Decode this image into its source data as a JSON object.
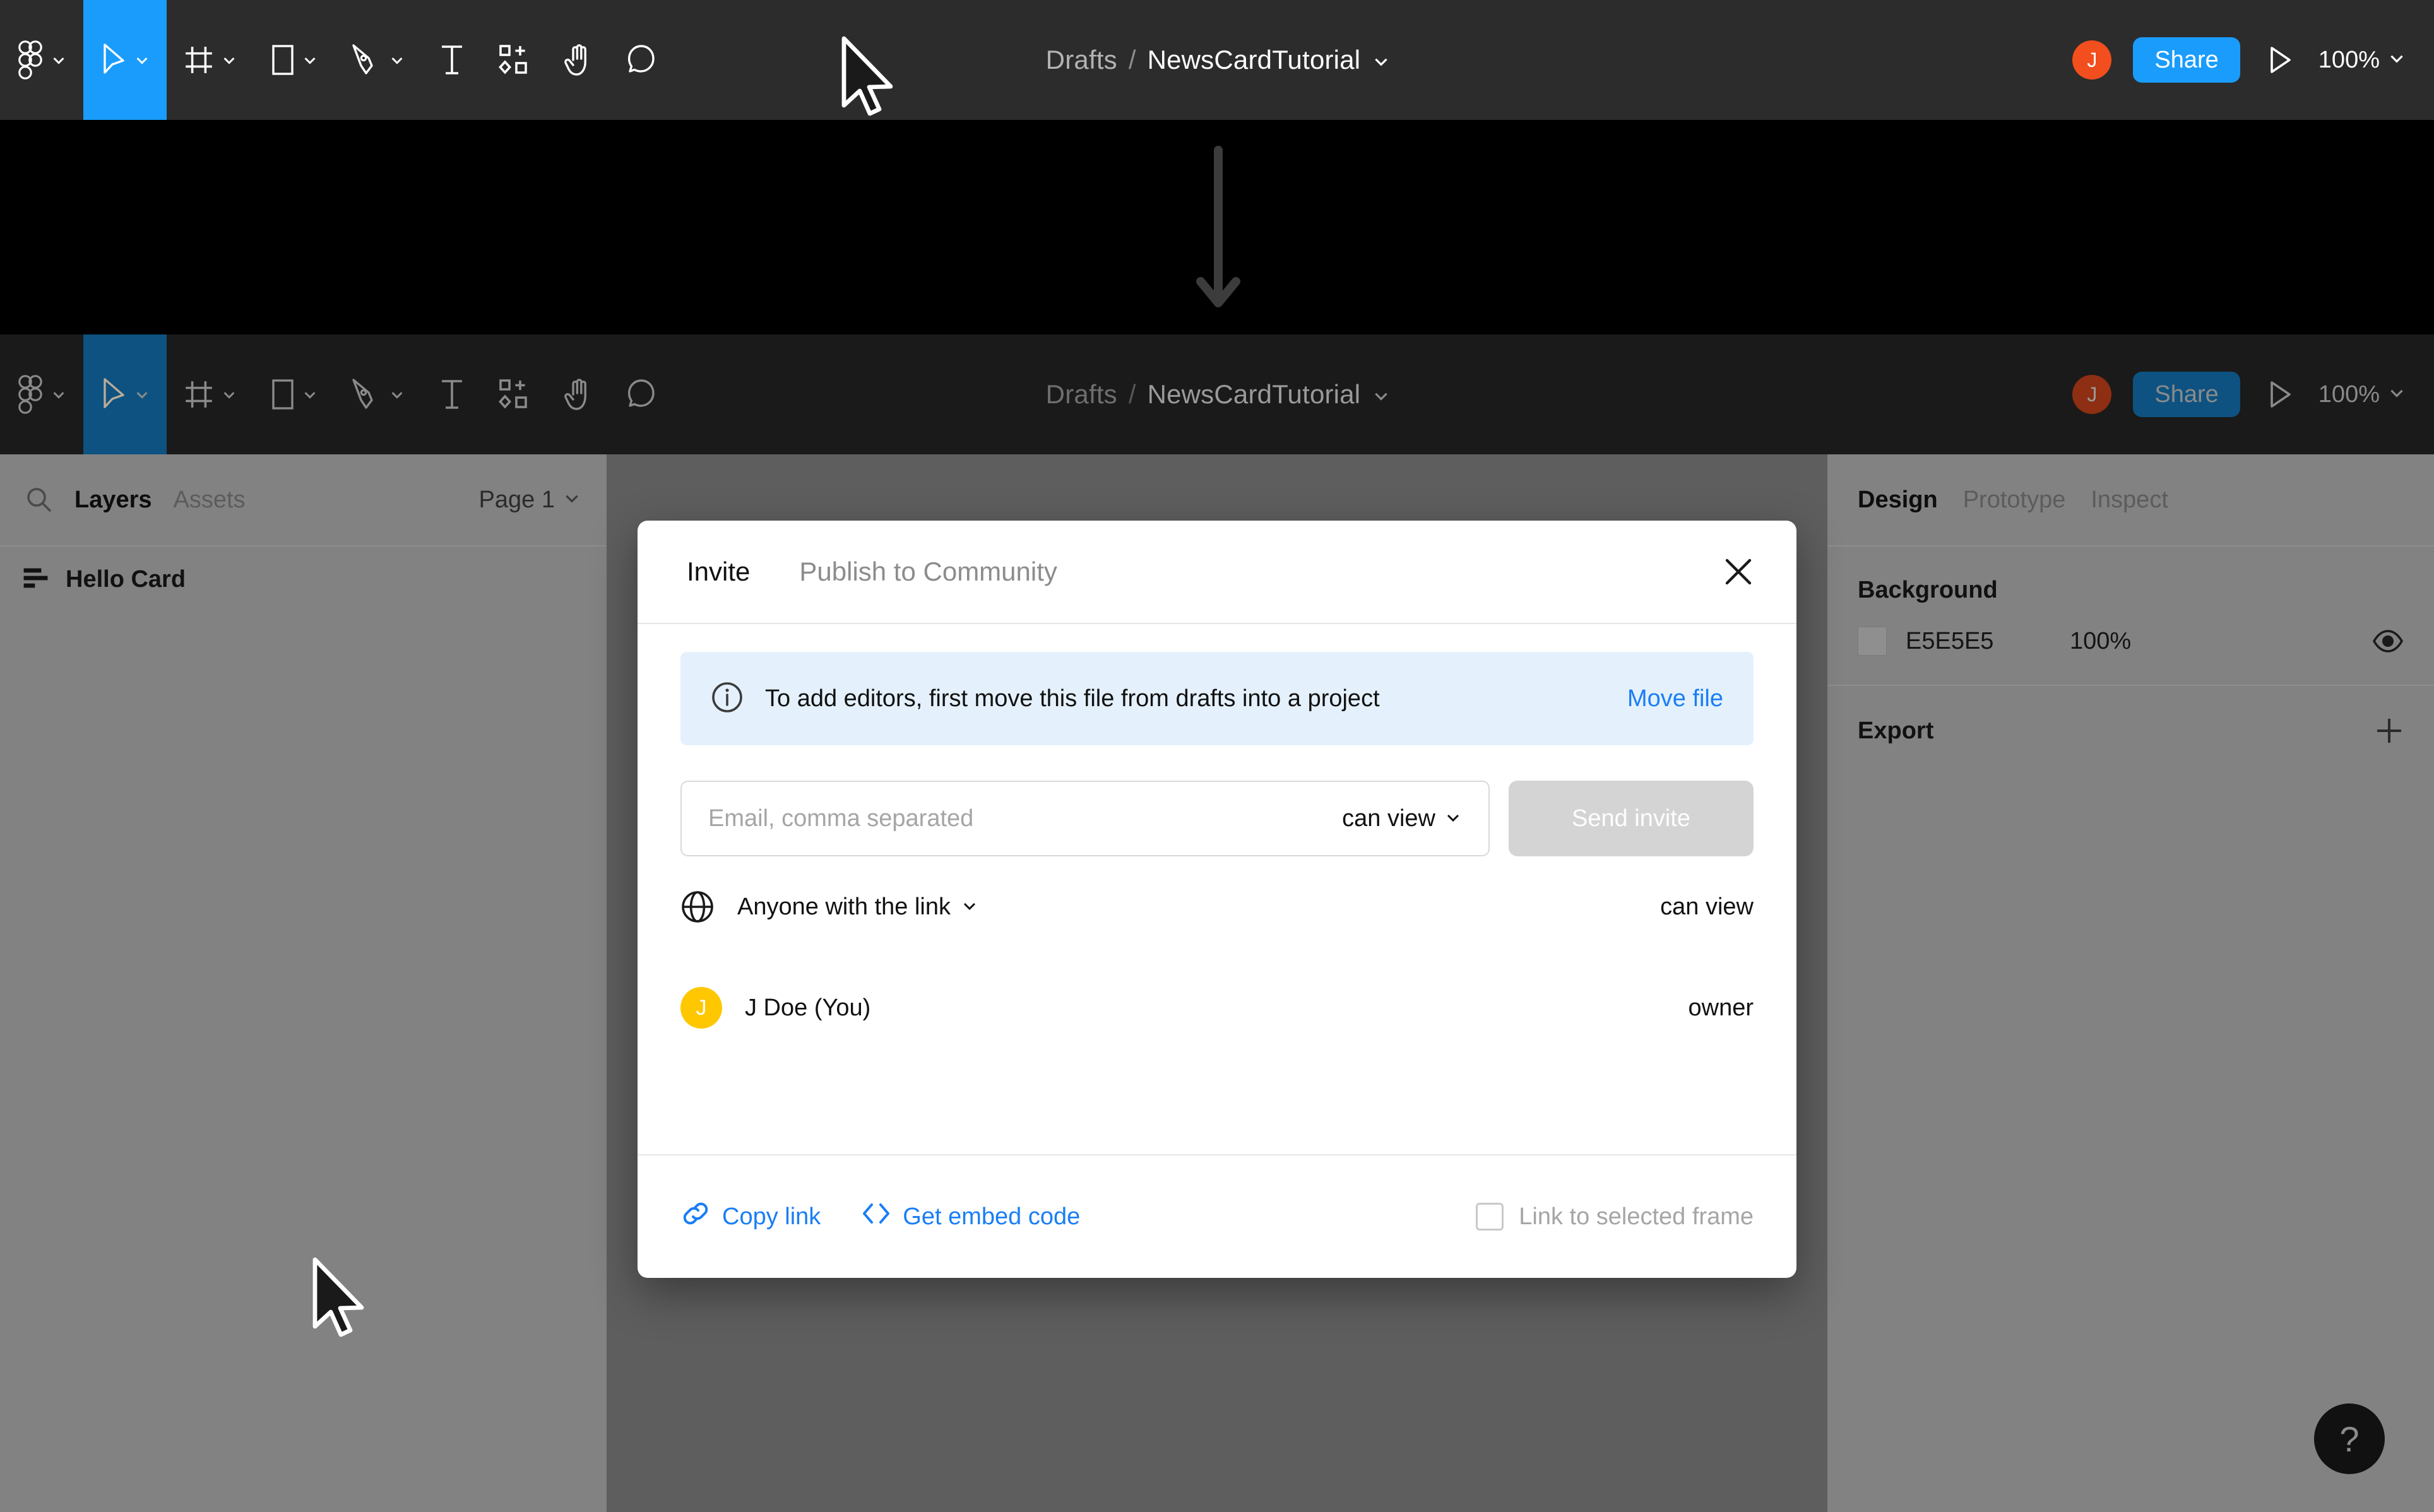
{
  "toolbar": {
    "tools": [
      {
        "name": "figma-menu",
        "icon": "figma-logo-icon",
        "has_chevron": true,
        "active": false
      },
      {
        "name": "move",
        "icon": "cursor-arrow-icon",
        "has_chevron": true,
        "active": true
      },
      {
        "name": "frame",
        "icon": "frame-icon",
        "has_chevron": true,
        "active": false
      },
      {
        "name": "shape",
        "icon": "rectangle-icon",
        "has_chevron": true,
        "active": false
      },
      {
        "name": "pen",
        "icon": "pen-icon",
        "has_chevron": true,
        "active": false
      },
      {
        "name": "text",
        "icon": "text-t-icon",
        "has_chevron": false,
        "active": false
      },
      {
        "name": "resources",
        "icon": "components-icon",
        "has_chevron": false,
        "active": false
      },
      {
        "name": "hand",
        "icon": "hand-icon",
        "has_chevron": false,
        "active": false
      },
      {
        "name": "comment",
        "icon": "comment-bubble-icon",
        "has_chevron": false,
        "active": false
      }
    ],
    "breadcrumb_project": "Drafts",
    "breadcrumb_separator": "/",
    "breadcrumb_file": "NewsCardTutorial",
    "avatar_initial": "J",
    "share_label": "Share",
    "present_icon": "play-triangle-icon",
    "zoom_level": "100%",
    "accent_blue": "#1A9CFC",
    "avatar_color": "#F24E1E"
  },
  "left_panel": {
    "search_icon": "search-icon",
    "tabs": [
      {
        "label": "Layers",
        "active": true
      },
      {
        "label": "Assets",
        "active": false
      }
    ],
    "page_selector": "Page 1",
    "layers": [
      {
        "name": "Hello Card",
        "icon": "frame-layer-icon"
      }
    ]
  },
  "right_panel": {
    "tabs": [
      {
        "label": "Design",
        "active": true
      },
      {
        "label": "Prototype",
        "active": false
      },
      {
        "label": "Inspect",
        "active": false
      }
    ],
    "background": {
      "title": "Background",
      "hex": "E5E5E5",
      "opacity": "100%",
      "visibility_icon": "eye-icon"
    },
    "export": {
      "title": "Export",
      "add_icon": "plus-icon"
    }
  },
  "help_button": {
    "label": "?"
  },
  "share_modal": {
    "tabs": [
      {
        "label": "Invite",
        "active": true
      },
      {
        "label": "Publish to Community",
        "active": false
      }
    ],
    "close_icon": "close-x-icon",
    "banner": {
      "icon": "info-circle-icon",
      "text": "To add editors, first move this file from drafts into a project",
      "link": "Move file",
      "background": "#E4F1FD",
      "link_color": "#1A7EF5"
    },
    "invite": {
      "email_placeholder": "Email, comma separated",
      "email_value": "",
      "permission": "can view",
      "send_label": "Send invite"
    },
    "rows": [
      {
        "icon": "globe-icon",
        "label": "Anyone with the link",
        "has_chevron": true,
        "permission": "can view"
      },
      {
        "icon": "avatar",
        "avatar_initial": "J",
        "avatar_color": "#FFC700",
        "label": "J Doe (You)",
        "has_chevron": false,
        "permission": "owner"
      }
    ],
    "footer": {
      "copy_link": {
        "icon": "link-chain-icon",
        "label": "Copy link"
      },
      "embed": {
        "icon": "code-brackets-icon",
        "label": "Get embed code"
      },
      "checkbox": {
        "label": "Link to selected frame",
        "checked": false
      }
    }
  },
  "annotation": {
    "arrow_icon": "down-arrow-icon"
  }
}
